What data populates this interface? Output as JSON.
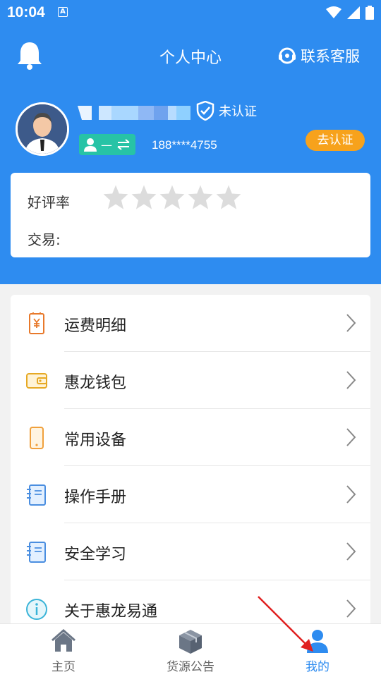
{
  "status_bar": {
    "time": "10:04",
    "notification_letter": "A"
  },
  "header": {
    "title": "个人中心",
    "contact_label": "联系客服"
  },
  "profile": {
    "verify_status": "未认证",
    "role_label": "—",
    "phone": "188****4755",
    "verify_button": "去认证"
  },
  "rating": {
    "label": "好评率",
    "stars_filled": 0,
    "stars_total": 5,
    "trade_label": "交易:"
  },
  "menu": {
    "items": [
      {
        "label": "运费明细",
        "icon": "freight-receipt-icon"
      },
      {
        "label": "惠龙钱包",
        "icon": "wallet-icon"
      },
      {
        "label": "常用设备",
        "icon": "phone-device-icon"
      },
      {
        "label": "操作手册",
        "icon": "manual-book-icon"
      },
      {
        "label": "安全学习",
        "icon": "safety-book-icon"
      },
      {
        "label": "关于惠龙易通",
        "icon": "info-icon"
      }
    ]
  },
  "tabbar": {
    "tabs": [
      {
        "label": "主页",
        "icon": "home-icon"
      },
      {
        "label": "货源公告",
        "icon": "cargo-box-icon"
      },
      {
        "label": "我的",
        "icon": "user-icon",
        "active": true
      }
    ]
  },
  "colors": {
    "primary": "#2e8cf0",
    "badge_green": "#27c3a6",
    "verify_orange": "#f7a21c",
    "annotation_red": "#e02020"
  }
}
